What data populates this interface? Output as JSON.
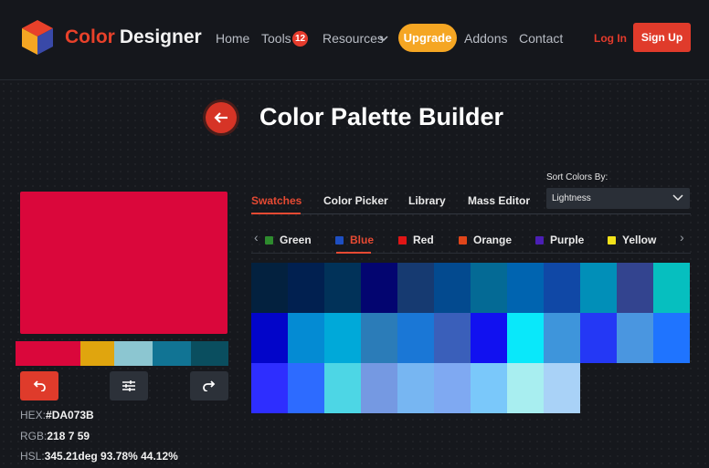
{
  "nav": {
    "brand_part1": "Color",
    "brand_part2": "Designer",
    "links": [
      "Home",
      "Tools",
      "Resources",
      "Addons",
      "Contact"
    ],
    "tools_badge": "12",
    "upgrade": "Upgrade",
    "login": "Log In",
    "signup": "Sign Up"
  },
  "page": {
    "title": "Color Palette Builder"
  },
  "current": {
    "hex_label": "HEX:",
    "hex_value": "#DA073B",
    "rgb_label": "RGB:",
    "rgb_value": "218 7 59",
    "hsl_label": "HSL:",
    "hsl_value": "345.21deg 93.78% 44.12%",
    "color": "#DA073B"
  },
  "palette_strip": [
    "#DA073B",
    "#E0A50E",
    "#8CC6D1",
    "#117494",
    "#0A4E5F"
  ],
  "tabs": [
    "Swatches",
    "Color Picker",
    "Library",
    "Mass Editor"
  ],
  "active_tab": "Swatches",
  "sort": {
    "label": "Sort Colors By:",
    "value": "Lightness"
  },
  "color_filters": [
    {
      "label": "Green",
      "color": "#2E8B2E"
    },
    {
      "label": "Blue",
      "color": "#1E4FC2"
    },
    {
      "label": "Red",
      "color": "#E01515"
    },
    {
      "label": "Orange",
      "color": "#E0451A"
    },
    {
      "label": "Purple",
      "color": "#4B1FB5"
    },
    {
      "label": "Yellow",
      "color": "#F2E21A"
    }
  ],
  "active_filter": "Blue",
  "swatches": [
    "#03213F",
    "#012050",
    "#013259",
    "#030570",
    "#163A71",
    "#034A8F",
    "#046A95",
    "#0064B0",
    "#1048A6",
    "#018FB8",
    "#33448F",
    "#06BFBF",
    "#0205C9",
    "#048BD3",
    "#00A9D9",
    "#2B7CB8",
    "#1A77D6",
    "#3A5FBA",
    "#1111F0",
    "#09E8FA",
    "#3E95DB",
    "#2438F5",
    "#4A96E0",
    "#1F74FF",
    "#2E2EFF",
    "#2D6BFF",
    "#4DD6E5",
    "#7599E2",
    "#77B6F2",
    "#7FA9F2",
    "#7AC8FA",
    "#A8EEF0",
    "#A9D2F7"
  ]
}
